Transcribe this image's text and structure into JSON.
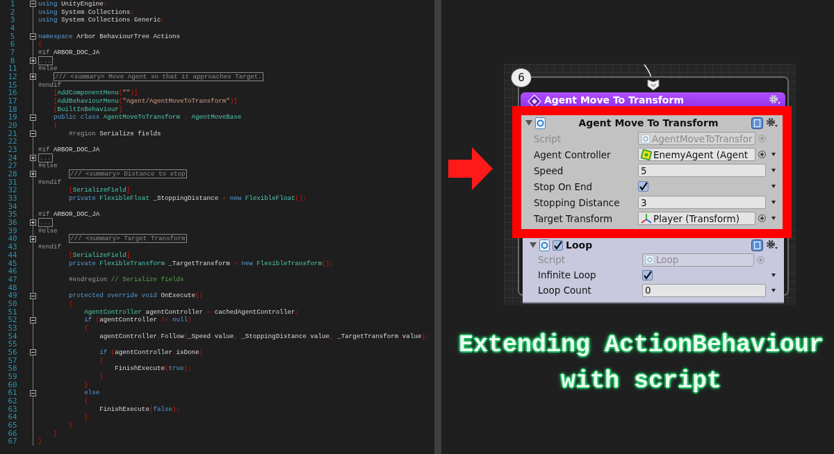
{
  "editor": {
    "lines": [
      {
        "num": "1",
        "expanded": true,
        "tokens": [
          {
            "kind": "kw",
            "text": "using"
          },
          {
            "kind": "text",
            "text": " UnityEngine;"
          }
        ]
      },
      {
        "num": "2",
        "tokens": [
          {
            "kind": "kw",
            "text": "using"
          },
          {
            "kind": "text",
            "text": " System.Collections;"
          }
        ]
      },
      {
        "num": "3",
        "tokens": [
          {
            "kind": "kw",
            "text": "using"
          },
          {
            "kind": "text",
            "text": " System.Collections.Generic;"
          }
        ]
      },
      {
        "num": "4"
      },
      {
        "num": "5",
        "expanded": true,
        "tokens": [
          {
            "kind": "kw",
            "text": "namespace"
          },
          {
            "kind": "text",
            "text": " Arbor.BehaviourTree.Actions"
          }
        ]
      },
      {
        "num": "6",
        "tokens": [
          {
            "kind": "text",
            "text": "{"
          }
        ]
      },
      {
        "num": "7",
        "tokens": [
          {
            "kind": "pre",
            "text": "#if"
          },
          {
            "kind": "text",
            "text": " ARBOR_DOC_JA"
          }
        ]
      },
      {
        "num": "8",
        "expanded": false,
        "tokens": [
          {
            "kind": "boxed",
            "text": "..."
          }
        ]
      },
      {
        "num": "11",
        "tokens": [
          {
            "kind": "pre",
            "text": "#else"
          }
        ]
      },
      {
        "num": "12",
        "expanded": false,
        "tokens": [
          {
            "kind": "boxed",
            "text": "    /// <summary> Move Agent so that it approaches Target."
          }
        ]
      },
      {
        "num": "15",
        "tokens": [
          {
            "kind": "pre",
            "text": "#endif"
          }
        ]
      },
      {
        "num": "16",
        "tokens": [
          {
            "kind": "text",
            "text": "    ["
          },
          {
            "kind": "type",
            "text": "AddComponentMenu"
          },
          {
            "kind": "text",
            "text": "("
          },
          {
            "kind": "str",
            "text": "\"\""
          },
          {
            "kind": "text",
            "text": ")]"
          }
        ]
      },
      {
        "num": "17",
        "tokens": [
          {
            "kind": "text",
            "text": "    ["
          },
          {
            "kind": "type",
            "text": "AddBehaviourMenu"
          },
          {
            "kind": "text",
            "text": "("
          },
          {
            "kind": "str",
            "text": "\"Agent/AgentMoveToTransform\""
          },
          {
            "kind": "text",
            "text": ")]"
          }
        ]
      },
      {
        "num": "18",
        "tokens": [
          {
            "kind": "text",
            "text": "    ["
          },
          {
            "kind": "type",
            "text": "BuiltInBehaviour"
          },
          {
            "kind": "text",
            "text": "]"
          }
        ]
      },
      {
        "num": "19",
        "expanded": true,
        "tokens": [
          {
            "kind": "kw",
            "text": "    public class "
          },
          {
            "kind": "type",
            "text": "AgentMoveToTransform"
          },
          {
            "kind": "text",
            "text": " : "
          },
          {
            "kind": "type",
            "text": "AgentMoveBase"
          }
        ]
      },
      {
        "num": "20",
        "tokens": [
          {
            "kind": "text",
            "text": "    {"
          }
        ]
      },
      {
        "num": "21",
        "expanded": true,
        "tokens": [
          {
            "kind": "pre",
            "text": "        #region"
          },
          {
            "kind": "text",
            "text": " Serialize fields"
          }
        ]
      },
      {
        "num": "22"
      },
      {
        "num": "23",
        "tokens": [
          {
            "kind": "pre",
            "text": "#if"
          },
          {
            "kind": "text",
            "text": " ARBOR_DOC_JA"
          }
        ]
      },
      {
        "num": "24",
        "expanded": false,
        "tokens": [
          {
            "kind": "boxed",
            "text": "..."
          }
        ]
      },
      {
        "num": "27",
        "tokens": [
          {
            "kind": "pre",
            "text": "#else"
          }
        ]
      },
      {
        "num": "28",
        "expanded": false,
        "tokens": [
          {
            "kind": "boxed",
            "text": "        /// <summary> Distance to stop"
          }
        ]
      },
      {
        "num": "31",
        "tokens": [
          {
            "kind": "pre",
            "text": "#endif"
          }
        ]
      },
      {
        "num": "32",
        "tokens": [
          {
            "kind": "text",
            "text": "        ["
          },
          {
            "kind": "type",
            "text": "SerializeField"
          },
          {
            "kind": "text",
            "text": "]"
          }
        ]
      },
      {
        "num": "33",
        "tokens": [
          {
            "kind": "kw",
            "text": "        private "
          },
          {
            "kind": "type",
            "text": "FlexibleFloat"
          },
          {
            "kind": "text",
            "text": " _StoppingDistance = "
          },
          {
            "kind": "kw",
            "text": "new "
          },
          {
            "kind": "type",
            "text": "FlexibleFloat"
          },
          {
            "kind": "text",
            "text": "();"
          }
        ]
      },
      {
        "num": "34"
      },
      {
        "num": "35",
        "tokens": [
          {
            "kind": "pre",
            "text": "#if"
          },
          {
            "kind": "text",
            "text": " ARBOR_DOC_JA"
          }
        ]
      },
      {
        "num": "36",
        "expanded": false,
        "tokens": [
          {
            "kind": "boxed",
            "text": "..."
          }
        ]
      },
      {
        "num": "39",
        "tokens": [
          {
            "kind": "pre",
            "text": "#else"
          }
        ]
      },
      {
        "num": "40",
        "expanded": false,
        "tokens": [
          {
            "kind": "boxed",
            "text": "        /// <summary> Target Transform"
          }
        ]
      },
      {
        "num": "43",
        "tokens": [
          {
            "kind": "pre",
            "text": "#endif"
          }
        ]
      },
      {
        "num": "44",
        "tokens": [
          {
            "kind": "text",
            "text": "        ["
          },
          {
            "kind": "type",
            "text": "SerializeField"
          },
          {
            "kind": "text",
            "text": "]"
          }
        ]
      },
      {
        "num": "45",
        "tokens": [
          {
            "kind": "kw",
            "text": "        private "
          },
          {
            "kind": "type",
            "text": "FlexibleTransform"
          },
          {
            "kind": "text",
            "text": " _TargetTransform = "
          },
          {
            "kind": "kw",
            "text": "new "
          },
          {
            "kind": "type",
            "text": "FlexibleTransform"
          },
          {
            "kind": "text",
            "text": "();"
          }
        ]
      },
      {
        "num": "46"
      },
      {
        "num": "47",
        "tokens": [
          {
            "kind": "pre",
            "text": "        #endregion "
          },
          {
            "kind": "green",
            "text": "// Serialize fields"
          }
        ]
      },
      {
        "num": "48"
      },
      {
        "num": "49",
        "expanded": true,
        "tokens": [
          {
            "kind": "kw",
            "text": "        protected override void"
          },
          {
            "kind": "text",
            "text": " OnExecute()"
          }
        ]
      },
      {
        "num": "50",
        "tokens": [
          {
            "kind": "text",
            "text": "        {"
          }
        ]
      },
      {
        "num": "51",
        "tokens": [
          {
            "kind": "type",
            "text": "            AgentController"
          },
          {
            "kind": "text",
            "text": " agentController = cachedAgentController;"
          }
        ]
      },
      {
        "num": "52",
        "expanded": true,
        "tokens": [
          {
            "kind": "kw",
            "text": "            if"
          },
          {
            "kind": "text",
            "text": " (agentController != "
          },
          {
            "kind": "kw",
            "text": "null"
          },
          {
            "kind": "text",
            "text": ")"
          }
        ]
      },
      {
        "num": "53",
        "tokens": [
          {
            "kind": "text",
            "text": "            {"
          }
        ]
      },
      {
        "num": "54",
        "tokens": [
          {
            "kind": "text",
            "text": "                agentController.Follow(_Speed.value, _StoppingDistance.value, _TargetTransform.value);"
          }
        ]
      },
      {
        "num": "55"
      },
      {
        "num": "56",
        "expanded": true,
        "tokens": [
          {
            "kind": "kw",
            "text": "                if"
          },
          {
            "kind": "text",
            "text": " (agentController.isDone)"
          }
        ]
      },
      {
        "num": "57",
        "tokens": [
          {
            "kind": "text",
            "text": "                {"
          }
        ]
      },
      {
        "num": "58",
        "tokens": [
          {
            "kind": "text",
            "text": "                    FinishExecute("
          },
          {
            "kind": "kw",
            "text": "true"
          },
          {
            "kind": "text",
            "text": ");"
          }
        ]
      },
      {
        "num": "59",
        "tokens": [
          {
            "kind": "text",
            "text": "                }"
          }
        ]
      },
      {
        "num": "60",
        "tokens": [
          {
            "kind": "text",
            "text": "            }"
          }
        ]
      },
      {
        "num": "61",
        "expanded": true,
        "tokens": [
          {
            "kind": "kw",
            "text": "            else"
          }
        ]
      },
      {
        "num": "62",
        "tokens": [
          {
            "kind": "text",
            "text": "            {"
          }
        ]
      },
      {
        "num": "63",
        "tokens": [
          {
            "kind": "text",
            "text": "                FinishExecute("
          },
          {
            "kind": "kw",
            "text": "false"
          },
          {
            "kind": "text",
            "text": ");"
          }
        ]
      },
      {
        "num": "64",
        "tokens": [
          {
            "kind": "text",
            "text": "            }"
          }
        ]
      },
      {
        "num": "65",
        "tokens": [
          {
            "kind": "text",
            "text": "        }"
          }
        ]
      },
      {
        "num": "66",
        "tokens": [
          {
            "kind": "text",
            "text": "    }"
          }
        ]
      },
      {
        "num": "67",
        "tokens": [
          {
            "kind": "text",
            "text": "}"
          }
        ]
      }
    ]
  },
  "node": {
    "number": "6",
    "title": "Agent Move To Transform",
    "components": [
      {
        "title": "Agent Move To Transform",
        "highlighted": true,
        "fields": [
          {
            "kind": "script",
            "label": "Script",
            "value": "AgentMoveToTransfor"
          },
          {
            "kind": "component",
            "label": "Agent Controller",
            "value": "EnemyAgent (Agent"
          },
          {
            "kind": "number",
            "label": "Speed",
            "value": "5"
          },
          {
            "kind": "toggle",
            "label": "Stop On End",
            "checked": true
          },
          {
            "kind": "number",
            "label": "Stopping Distance",
            "value": "3"
          },
          {
            "kind": "transform",
            "label": "Target Transform",
            "value": "Player (Transform)"
          }
        ]
      },
      {
        "title": "Loop",
        "highlighted": false,
        "enabled": true,
        "fields": [
          {
            "kind": "script",
            "label": "Script",
            "value": "Loop"
          },
          {
            "kind": "toggle",
            "label": "Infinite Loop",
            "checked": true
          },
          {
            "kind": "number",
            "label": "Loop Count",
            "value": "0"
          }
        ]
      }
    ]
  },
  "caption": [
    "Extending ActionBehaviour",
    "with script"
  ]
}
